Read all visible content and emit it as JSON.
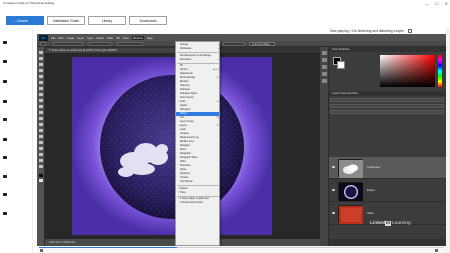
{
  "window": {
    "title": "Complete Guide for Photoshop Editing",
    "controls": [
      "—",
      "☐",
      "✕"
    ]
  },
  "nav": {
    "tabs": [
      {
        "label": "Course",
        "active": true
      },
      {
        "label": "Installation Guide",
        "active": false
      },
      {
        "label": "Library",
        "active": false
      },
      {
        "label": "Downloads",
        "active": false
      }
    ]
  },
  "now_playing": {
    "text": "Now playing > De-flowering and distorting a layer"
  },
  "photoshop": {
    "logo": "Ps",
    "menus": [
      "File",
      "Edit",
      "Image",
      "Layer",
      "Type",
      "Select",
      "Filter",
      "3D",
      "View",
      "Window",
      "Help"
    ],
    "active_menu": "Window",
    "options_button": "Select and Mask...",
    "document_tab": "© Solar eclipse on glitter.psd @ 100% (Vivid Light, RGB/8*)",
    "status": "100%    Doc: 9.9M/48.2M",
    "window_menu": [
      {
        "label": "Arrange",
        "has_sub": true
      },
      {
        "label": "Workspace",
        "has_sub": true
      },
      {
        "sep": true
      },
      {
        "label": "Find Extensions on Exchange..."
      },
      {
        "label": "Extensions",
        "has_sub": true
      },
      {
        "sep": true
      },
      {
        "label": "3D"
      },
      {
        "label": "Actions",
        "shortcut": "Alt+F9"
      },
      {
        "label": "Adjustments"
      },
      {
        "label": "Brush Settings",
        "shortcut": "F5"
      },
      {
        "label": "Brushes"
      },
      {
        "label": "Channels"
      },
      {
        "label": "Character"
      },
      {
        "label": "Character Styles"
      },
      {
        "label": "Clone Source"
      },
      {
        "label": "Color",
        "shortcut": "F6",
        "checked": true
      },
      {
        "label": "Glyphs"
      },
      {
        "label": "Histogram"
      },
      {
        "label": "History",
        "highlighted": true
      },
      {
        "label": "Info",
        "shortcut": "F8"
      },
      {
        "label": "Layer Comps"
      },
      {
        "label": "Layers",
        "shortcut": "F7",
        "checked": true
      },
      {
        "label": "Learn"
      },
      {
        "label": "Libraries"
      },
      {
        "label": "Measurement Log"
      },
      {
        "label": "Modifier Keys"
      },
      {
        "label": "Navigator"
      },
      {
        "label": "Notes"
      },
      {
        "label": "Paragraph"
      },
      {
        "label": "Paragraph Styles"
      },
      {
        "label": "Paths"
      },
      {
        "label": "Properties"
      },
      {
        "label": "Styles"
      },
      {
        "label": "Swatches"
      },
      {
        "label": "Timeline"
      },
      {
        "label": "Tool Presets"
      },
      {
        "sep": true
      },
      {
        "label": "Options",
        "checked": true
      },
      {
        "label": "Tools",
        "checked": true
      },
      {
        "sep": true
      },
      {
        "label": "1 Solar eclipse on glitter.psd",
        "checked": true
      },
      {
        "label": "2 Cloud facial sort.psd"
      }
    ],
    "panels": {
      "color_header": "Color   Swatches",
      "color_accent": "#ff0000",
      "layers_header": "Layers   Channels   Paths",
      "layers": [
        {
          "name": "smoke layer",
          "thumb": "cloud",
          "selected": true
        },
        {
          "name": "Eclipse",
          "thumb": "eclipse",
          "selected": false
        },
        {
          "name": "Glitter",
          "thumb": "glitter",
          "selected": false
        }
      ]
    }
  },
  "watermark": {
    "brand": "Linked",
    "brand2": "in",
    "suffix": "Learning"
  },
  "player": {
    "progress": 0.34
  }
}
